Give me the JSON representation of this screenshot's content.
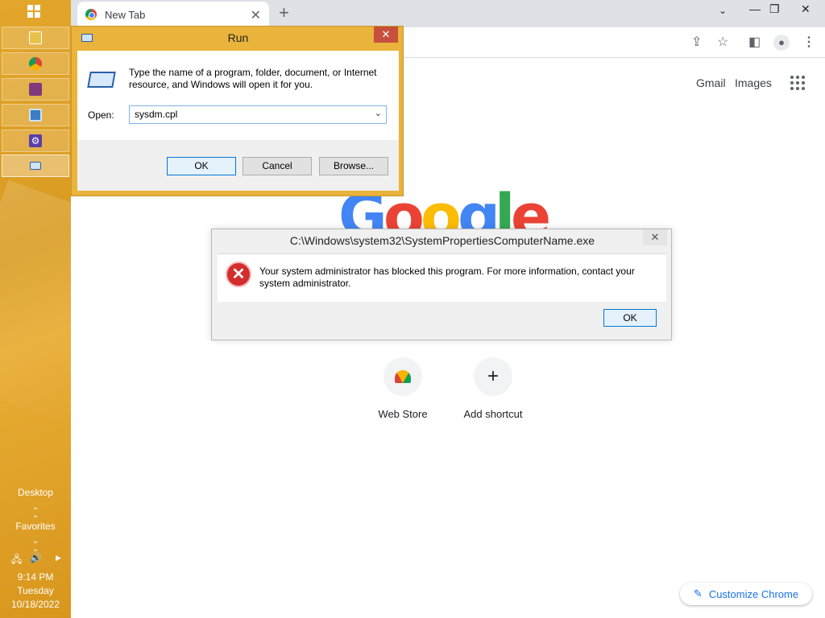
{
  "taskbar": {
    "items": [
      {
        "name": "file-explorer",
        "icon": "folder-icon",
        "color": "#e8c14a"
      },
      {
        "name": "chrome",
        "icon": "chrome-icon",
        "color": "#4285f4"
      },
      {
        "name": "onenote",
        "icon": "onenote-icon",
        "color": "#80397b"
      },
      {
        "name": "remote-desktop",
        "icon": "monitor-icon",
        "color": "#3b7dc4"
      },
      {
        "name": "settings",
        "icon": "gear-icon",
        "color": "#5b3fa8"
      },
      {
        "name": "run",
        "icon": "run-icon",
        "color": "#2a5ea8"
      }
    ],
    "desktop_label": "Desktop",
    "favorites_label": "Favorites",
    "time": "9:14 PM",
    "day": "Tuesday",
    "date": "10/18/2022"
  },
  "browser": {
    "tab_title": "New Tab",
    "gmail": "Gmail",
    "images": "Images",
    "shortcuts": [
      {
        "label": "Web Store",
        "icon": "web-store-icon"
      },
      {
        "label": "Add shortcut",
        "icon": "plus-icon"
      }
    ],
    "customize_label": "Customize Chrome",
    "logo_text": "Google"
  },
  "run_dialog": {
    "title": "Run",
    "description": "Type the name of a program, folder, document, or Internet resource, and Windows will open it for you.",
    "open_label": "Open:",
    "open_value": "sysdm.cpl",
    "ok_label": "OK",
    "cancel_label": "Cancel",
    "browse_label": "Browse..."
  },
  "error_dialog": {
    "title": "C:\\Windows\\system32\\SystemPropertiesComputerName.exe",
    "message": "Your system administrator has blocked this program. For more information, contact your system administrator.",
    "ok_label": "OK"
  }
}
